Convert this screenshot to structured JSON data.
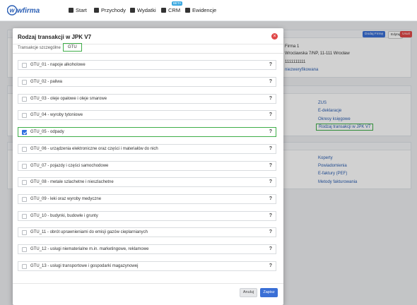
{
  "nav": {
    "logo": "wfirma",
    "items": [
      {
        "label": "Start",
        "icon": "home-icon"
      },
      {
        "label": "Przychody",
        "icon": "income-icon"
      },
      {
        "label": "Wydatki",
        "icon": "wallet-icon"
      },
      {
        "label": "CRM",
        "icon": "crm-icon"
      },
      {
        "label": "Ewidencje",
        "icon": "folder-icon"
      }
    ],
    "beta": "BETA"
  },
  "background": {
    "company": {
      "name": "Firma 1",
      "address": "Wroclawska 7/NP, 11-111 Wrocław",
      "nip": "1111111111",
      "status": "niezweryfikowana",
      "add_button": "Dodaj Firmę",
      "edit_button": "Edytuj",
      "delete_button": "Usuń"
    },
    "links1": [
      "ZUS",
      "E-deklaracje",
      "Okresy księgowe",
      "Rodzaj transakcji w JPK V7"
    ],
    "links2": [
      "Koperty",
      "Powiadomienia",
      "E-faktury (PEF)",
      "Metody fakturowania"
    ]
  },
  "modal": {
    "title": "Rodzaj transakcji w JPK V7",
    "tabs": [
      "Transakcje szczególne",
      "GTU"
    ],
    "items": [
      {
        "label": "GTU_01 - napoje alkoholowe",
        "checked": false
      },
      {
        "label": "GTU_02 - paliwa",
        "checked": false
      },
      {
        "label": "GTU_03 - oleje opałowe i oleje smarowe",
        "checked": false
      },
      {
        "label": "GTU_04 - wyroby tytoniowe",
        "checked": false
      },
      {
        "label": "GTU_05 - odpady",
        "checked": true
      },
      {
        "label": "GTU_06 - urządzenia elektroniczne oraz części i materiałów do nich",
        "checked": false
      },
      {
        "label": "GTU_07 - pojazdy i części samochodowe",
        "checked": false
      },
      {
        "label": "GTU_08 - metale szlachetne i nieszlachetne",
        "checked": false
      },
      {
        "label": "GTU_09 - leki oraz wyroby medyczne",
        "checked": false
      },
      {
        "label": "GTU_10 - budynki, budowle i grunty",
        "checked": false
      },
      {
        "label": "GTU_11 - obrót uprawnieniami do emisji gazów cieplarnianych",
        "checked": false
      },
      {
        "label": "GTU_12 - usługi niematerialne m.in. marketingowe, reklamowe",
        "checked": false
      },
      {
        "label": "GTU_13 - usługi transportowe i gospodarki magazynowej",
        "checked": false
      }
    ],
    "help": "?",
    "cancel": "Anuluj",
    "save": "Zapisz"
  },
  "colors": {
    "highlight": "#3fae49",
    "primary": "#3a6fd6",
    "danger": "#e04848"
  }
}
